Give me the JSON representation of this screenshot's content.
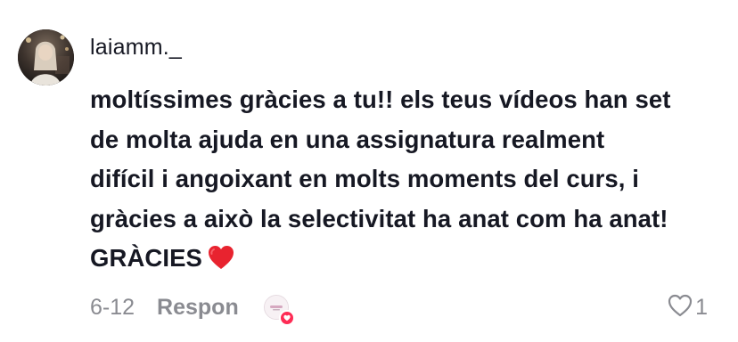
{
  "comment": {
    "username": "laiamm._",
    "text_lines": [
      "moltíssimes gràcies a tu!! els teus vídeos han set",
      "de molta ajuda en una assignatura realment",
      "difícil i angoixant en molts moments del curs, i",
      "gràcies a això la selectivitat ha anat com ha anat!",
      "GRÀCIES"
    ],
    "emoji": "❤️",
    "date": "6-12",
    "reply_label": "Respon",
    "like_count": "1"
  },
  "colors": {
    "text": "#161823",
    "muted": "#8a8b91",
    "accent_heart": "#fe2c55",
    "emoji_heart": "#e8232f"
  },
  "icons": {
    "avatar": "user-avatar",
    "creator_liked": "creator-liked-icon",
    "like": "heart-outline-icon",
    "emoji": "red-heart-emoji"
  }
}
